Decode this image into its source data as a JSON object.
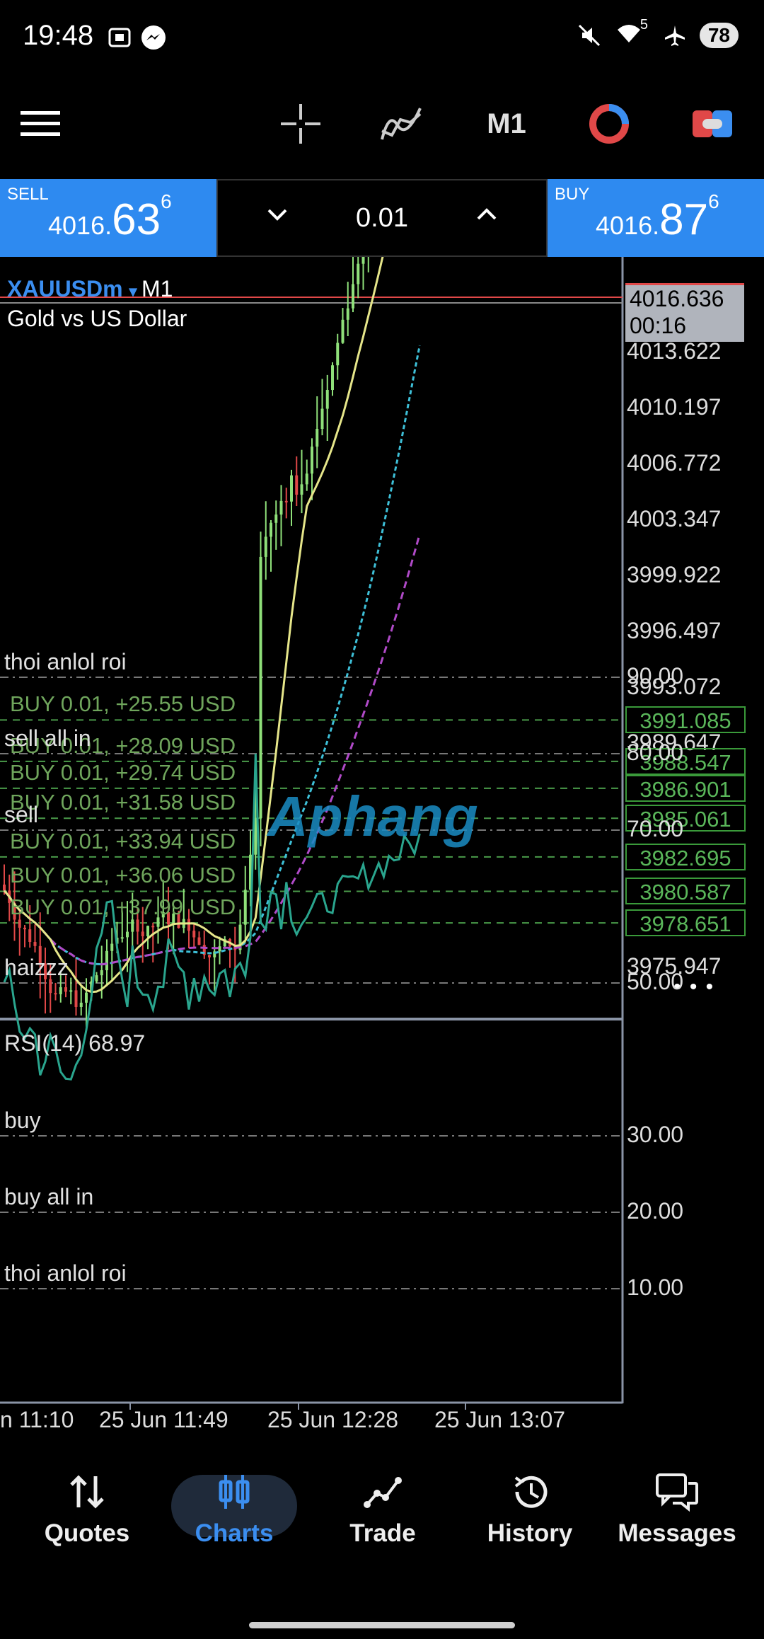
{
  "status_bar": {
    "time": "19:48",
    "battery": "78",
    "signal_badge": "5"
  },
  "toolbar": {
    "timeframe": "M1"
  },
  "trade_panel": {
    "sell": {
      "label": "SELL",
      "price_prefix": "4016.",
      "price_big": "63",
      "price_sup": "6"
    },
    "buy": {
      "label": "BUY",
      "price_prefix": "4016.",
      "price_big": "87",
      "price_sup": "6"
    },
    "lot": "0.01"
  },
  "chart": {
    "symbol": "XAUUSDm",
    "symbol_arrow": "▾",
    "timeframe": "M1",
    "description": "Gold vs US Dollar",
    "current_price": "4016.636",
    "countdown": "00:16",
    "price_axis": [
      "4013.622",
      "4010.197",
      "4006.772",
      "4003.347",
      "3999.922",
      "3996.497",
      "3993.072",
      "3989.647",
      "3975.947"
    ],
    "more": "• • •",
    "watermark": "Aphang",
    "positions": [
      {
        "label": "BUY 0.01,  +25.55 USD",
        "price": "3991.085"
      },
      {
        "label": "BUY 0.01,  +28.09 USD",
        "price": "3988.547"
      },
      {
        "label": "BUY 0.01,  +29.74 USD",
        "price": "3986.901"
      },
      {
        "label": "BUY 0.01,  +31.58 USD",
        "price": "3985.061"
      },
      {
        "label": "BUY 0.01,  +33.94 USD",
        "price": "3982.695"
      },
      {
        "label": "BUY 0.01,  +36.06 USD",
        "price": "3980.587"
      },
      {
        "label": "BUY 0.01,  +37.99 USD",
        "price": "3978.651"
      }
    ],
    "time_axis": [
      "n 11:10",
      "25 Jun 11:49",
      "25 Jun 12:28",
      "25 Jun 13:07"
    ]
  },
  "rsi": {
    "title": "RSI(14) 68.97",
    "levels": [
      {
        "value": "90.00",
        "label": "thoi anlol roi"
      },
      {
        "value": "80.00",
        "label": "sell all in"
      },
      {
        "value": "70.00",
        "label": "sell"
      },
      {
        "value": "50.00",
        "label": "haizzz"
      },
      {
        "value": "30.00",
        "label": "buy"
      },
      {
        "value": "20.00",
        "label": "buy all in"
      },
      {
        "value": "10.00",
        "label": "thoi anlol roi"
      }
    ]
  },
  "nav": [
    {
      "label": "Quotes",
      "icon": "quotes-icon"
    },
    {
      "label": "Charts",
      "icon": "charts-icon",
      "active": true
    },
    {
      "label": "Trade",
      "icon": "trade-icon"
    },
    {
      "label": "History",
      "icon": "history-icon"
    },
    {
      "label": "Messages",
      "icon": "messages-icon"
    }
  ],
  "colors": {
    "accent": "#2e8af0",
    "bull": "#8fe07a",
    "bear": "#e04848",
    "ma_yellow": "#e6e68a",
    "ma_purple": "#b04ac8",
    "ma_cyan": "#3ec0d8",
    "rsi_line": "#2aa58e",
    "position_line": "#4a9a4a"
  }
}
